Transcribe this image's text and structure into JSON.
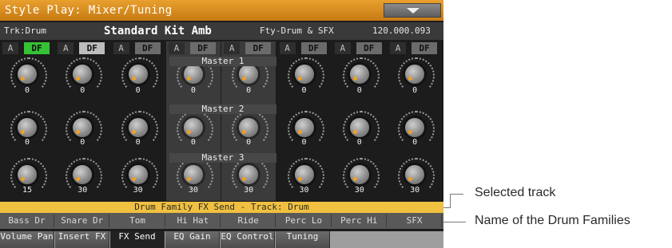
{
  "title": "Style Play: Mixer/Tuning",
  "track": {
    "trk": "Trk:Drum",
    "kit": "Standard Kit Amb",
    "family": "Fty-Drum & SFX",
    "number": "120.000.093"
  },
  "adf": {
    "a": "A",
    "df": "DF"
  },
  "masters": [
    "Master 1",
    "Master 2",
    "Master 3"
  ],
  "rows": [
    {
      "values": [
        "0",
        "0",
        "0",
        "0",
        "0",
        "0",
        "0",
        "0"
      ]
    },
    {
      "values": [
        "0",
        "0",
        "0",
        "0",
        "0",
        "0",
        "0",
        "0"
      ]
    },
    {
      "values": [
        "15",
        "30",
        "30",
        "30",
        "30",
        "30",
        "30",
        "30"
      ]
    }
  ],
  "info": "Drum Family FX Send - Track: Drum",
  "families": [
    "Bass Dr",
    "Snare Dr",
    "Tom",
    "Hi Hat",
    "Ride",
    "Perc Lo",
    "Perc Hi",
    "SFX"
  ],
  "tabs": [
    {
      "label": "Volume Pan",
      "active": false
    },
    {
      "label": "Insert FX",
      "active": false
    },
    {
      "label": "FX Send",
      "active": true
    },
    {
      "label": "EQ Gain",
      "active": false
    },
    {
      "label": "EQ Control",
      "active": false
    },
    {
      "label": "Tuning",
      "active": false
    }
  ],
  "callouts": {
    "selected_track": "Selected track",
    "families_name": "Name of the Drum Families"
  },
  "colors": {
    "title_bar": "#d98c1e",
    "info_bar": "#f0c040",
    "df_on": "#35c235",
    "knob_dot": "#f4a020"
  }
}
